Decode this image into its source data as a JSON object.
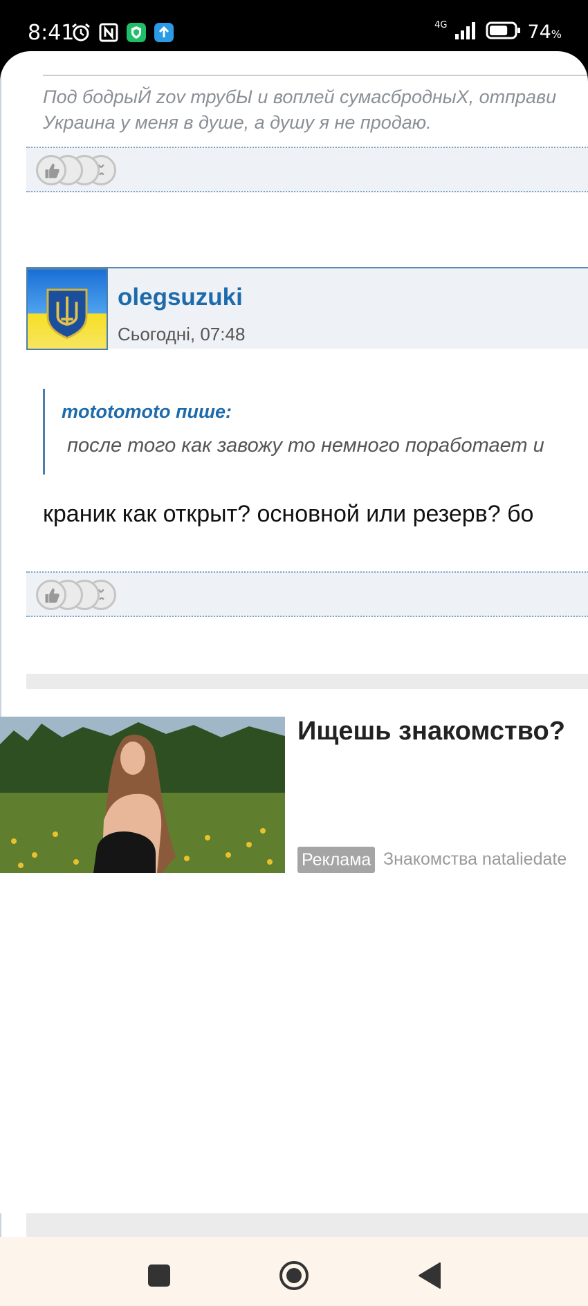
{
  "status_bar": {
    "time": "8:41",
    "network": "4G",
    "battery_percent": "74",
    "battery_unit": "%",
    "battery_level": 0.74,
    "icons": [
      "alarm-icon",
      "nfc-icon",
      "security-shield-icon",
      "upload-arrow-icon",
      "signal-icon",
      "battery-icon"
    ]
  },
  "post1": {
    "signature_line1": "Под бодрыЙ zov трубЫ и воплей сумасбродныХ, отправи",
    "signature_line2": "Украина у меня в душе, а душу я не продаю."
  },
  "post2": {
    "username": "olegsuzuki",
    "time": "Сьогодні, 07:48",
    "quote_author": "mototomoto пише:",
    "quote_text": "после того как завожу то немного поработает и",
    "body": "краник как открыт? основной или резерв?  бо"
  },
  "reactions": [
    "like-icon",
    "neutral-face-icon",
    "sad-face-icon",
    "angry-face-icon"
  ],
  "ad": {
    "title": "Ищешь знакомство?",
    "badge": "Реклама",
    "source": "Знакомства nataliedate"
  },
  "nav": {
    "icons": [
      "recent-apps-icon",
      "home-icon",
      "back-icon"
    ]
  },
  "colors": {
    "link_blue": "#1d6bab",
    "react_bar_bg": "#eef1f5",
    "nav_bg": "#fdf5ec"
  }
}
